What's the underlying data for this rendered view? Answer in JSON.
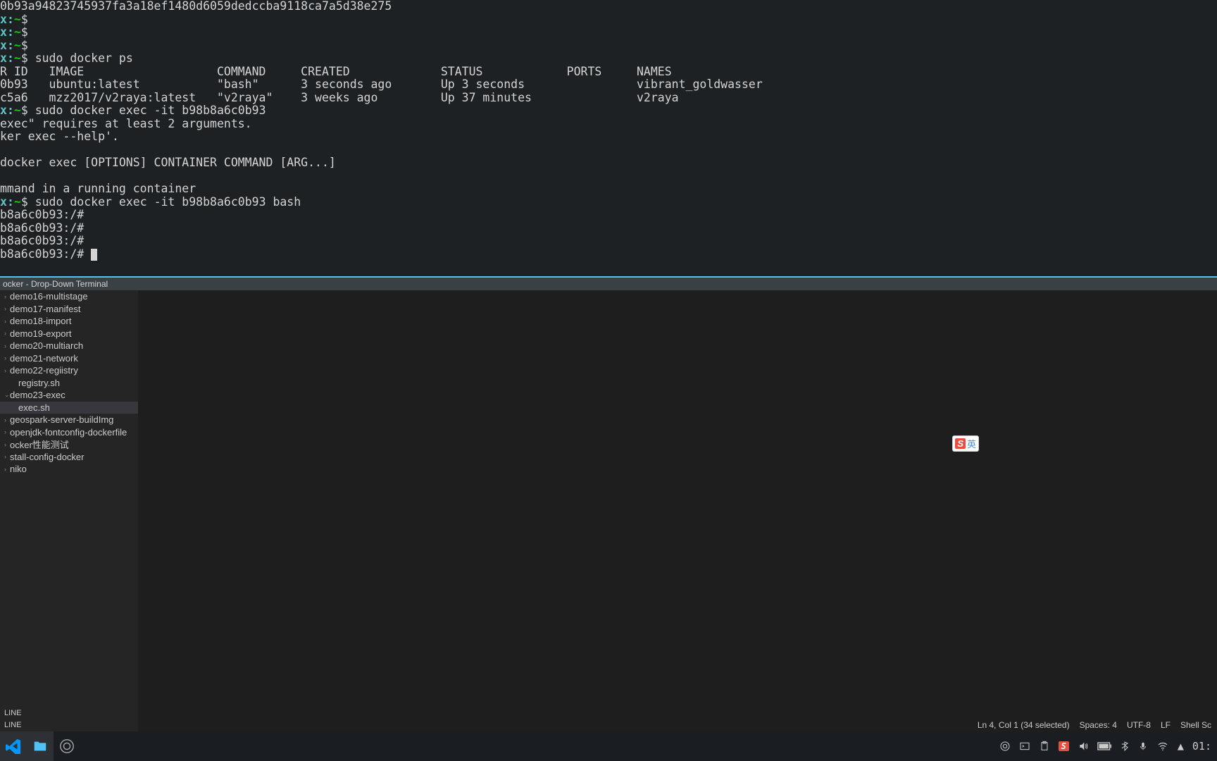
{
  "terminal": {
    "line_hash": "0b93a94823745937fa3a18ef1480d6059dedccba9118ca7a5d38e275",
    "host_prefix": "x",
    "path": "~",
    "dollar": "$",
    "cmd_ps": "sudo docker ps",
    "header": "R ID   IMAGE                   COMMAND     CREATED             STATUS            PORTS     NAMES",
    "row1": "0b93   ubuntu:latest           \"bash\"      3 seconds ago       Up 3 seconds                vibrant_goldwasser",
    "row2": "c5a6   mzz2017/v2raya:latest   \"v2raya\"    3 weeks ago         Up 37 minutes               v2raya",
    "cmd_exec1": "sudo docker exec -it b98b8a6c0b93",
    "err1": "exec\" requires at least 2 arguments.",
    "err2": "ker exec --help'.",
    "usage": "docker exec [OPTIONS] CONTAINER COMMAND [ARG...]",
    "desc": "mmand in a running container",
    "cmd_exec2": "sudo docker exec -it b98b8a6c0b93 bash",
    "root1": "b8a6c0b93:/#",
    "root2": "b8a6c0b93:/#",
    "root3": "b8a6c0b93:/#",
    "root4": "b8a6c0b93:/# "
  },
  "titlebar": "ocker - Drop-Down Terminal",
  "tree": {
    "items": [
      {
        "label": "demo16-multistage",
        "indent": 0,
        "arrow": ">"
      },
      {
        "label": "demo17-manifest",
        "indent": 0,
        "arrow": ">"
      },
      {
        "label": "demo18-import",
        "indent": 0,
        "arrow": ">"
      },
      {
        "label": "demo19-export",
        "indent": 0,
        "arrow": ">"
      },
      {
        "label": "demo20-multiarch",
        "indent": 0,
        "arrow": ">"
      },
      {
        "label": "demo21-network",
        "indent": 0,
        "arrow": ">"
      },
      {
        "label": "demo22-regiistry",
        "indent": 0,
        "arrow": ">"
      },
      {
        "label": "registry.sh",
        "indent": 1,
        "arrow": ""
      },
      {
        "label": "demo23-exec",
        "indent": 0,
        "arrow": "v",
        "selected": false
      },
      {
        "label": "exec.sh",
        "indent": 1,
        "arrow": "",
        "selected": true
      },
      {
        "label": "geospark-server-buildImg",
        "indent": 0,
        "arrow": ">"
      },
      {
        "label": "openjdk-fontconfig-dockerfile",
        "indent": 0,
        "arrow": ">"
      },
      {
        "label": "ocker性能测试",
        "indent": 0,
        "arrow": ">"
      },
      {
        "label": "stall-config-docker",
        "indent": 0,
        "arrow": ">"
      },
      {
        "label": "niko",
        "indent": 0,
        "arrow": ">"
      }
    ]
  },
  "panels": {
    "p1": "LINE",
    "p2": "LINE"
  },
  "status": {
    "pos": "Ln 4, Col 1 (34 selected)",
    "spaces": "Spaces: 4",
    "enc": "UTF-8",
    "eol": "LF",
    "lang": "Shell Sc"
  },
  "ime": {
    "s": "S",
    "lang": "英"
  },
  "clock": "01:"
}
